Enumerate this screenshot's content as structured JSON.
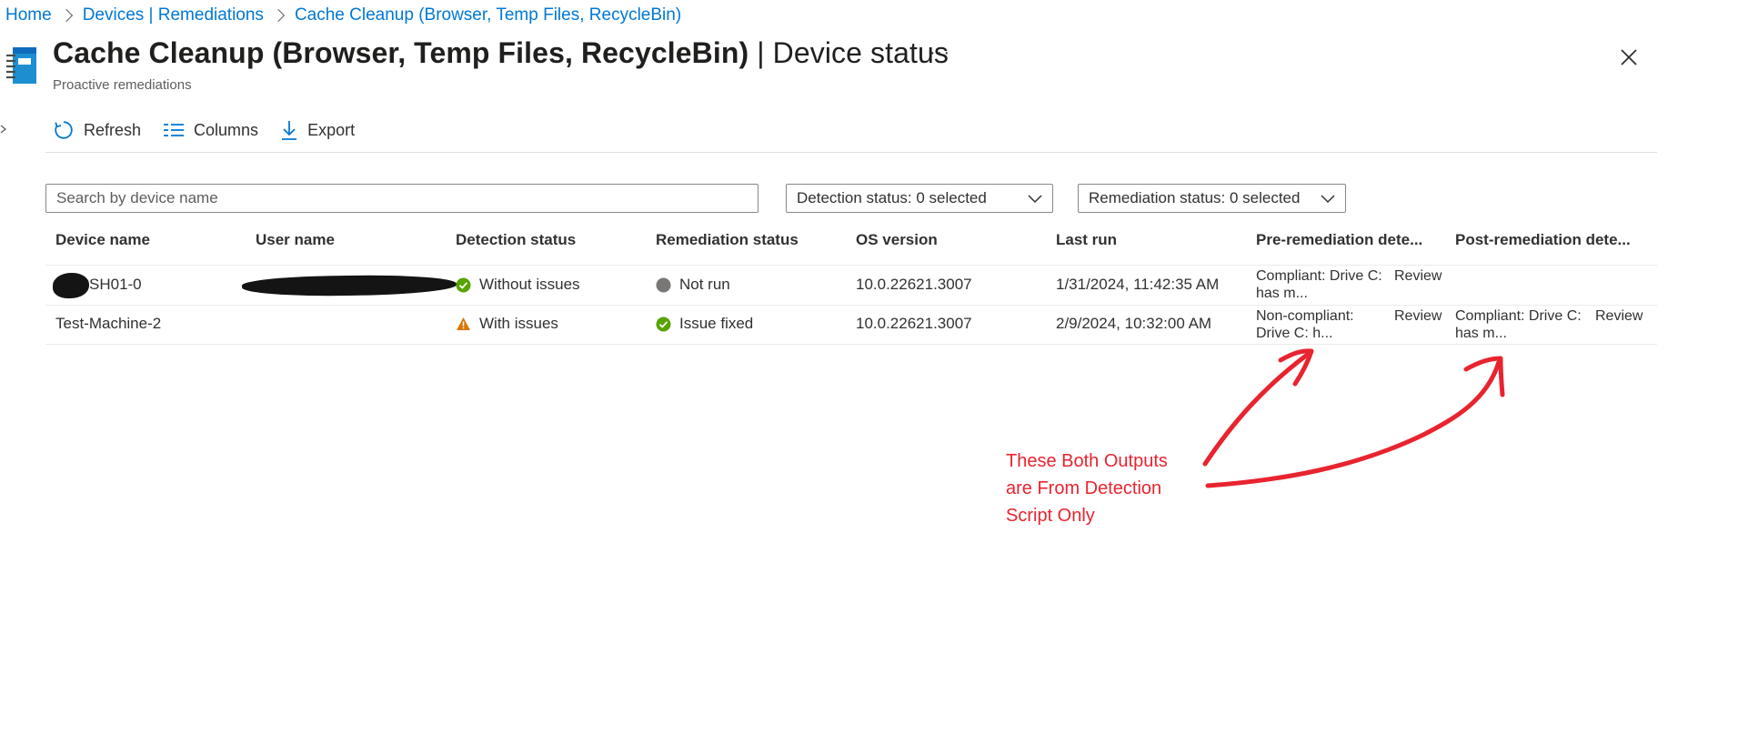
{
  "breadcrumb": {
    "items": [
      "Home",
      "Devices | Remediations",
      "Cache Cleanup (Browser, Temp Files, RecycleBin)"
    ]
  },
  "header": {
    "title_main": "Cache Cleanup (Browser, Temp Files, RecycleBin)",
    "title_separator": " | ",
    "title_page": "Device status",
    "subtitle": "Proactive remediations",
    "more_label": "···",
    "icon": "remediation-script-icon",
    "close_icon": "close-icon"
  },
  "toolbar": {
    "refresh_label": "Refresh",
    "columns_label": "Columns",
    "export_label": "Export"
  },
  "filters": {
    "search_placeholder": "Search by device name",
    "search_value": "",
    "detection_status": "Detection status: 0 selected",
    "remediation_status": "Remediation status: 0 selected"
  },
  "table": {
    "columns": [
      "Device name",
      "User name",
      "Detection status",
      "Remediation status",
      "OS version",
      "Last run",
      "Pre-remediation dete...",
      "Post-remediation dete..."
    ],
    "rows": [
      {
        "device": "SH01-0",
        "user": "",
        "detection": "Without issues",
        "detection_icon": "check-circle-icon",
        "remediation": "Not run",
        "remediation_icon": "gray-dot-icon",
        "os": "10.0.22621.3007",
        "last_run": "1/31/2024, 11:42:35 AM",
        "pre_line1": "Compliant: Drive C:",
        "pre_line2": "has m...",
        "pre_link": "Review",
        "post_line1": "",
        "post_line2": "",
        "post_link": ""
      },
      {
        "device": "Test-Machine-2",
        "user": "",
        "detection": "With issues",
        "detection_icon": "warning-icon",
        "remediation": "Issue fixed",
        "remediation_icon": "check-circle-icon",
        "os": "10.0.22621.3007",
        "last_run": "2/9/2024, 10:32:00 AM",
        "pre_line1": "Non-compliant:",
        "pre_line2": "Drive C: h...",
        "pre_link": "Review",
        "post_line1": "Compliant: Drive C:",
        "post_line2": "has m...",
        "post_link": "Review"
      }
    ]
  },
  "annotation": {
    "lines": [
      "These Both Outputs",
      "are From Detection",
      "Script Only"
    ],
    "color": "#e8242f"
  },
  "colors": {
    "link": "#0078d4",
    "success": "#57a300",
    "warning": "#db7500",
    "neutral_dot": "#797775",
    "annotation": "#e8242f"
  }
}
